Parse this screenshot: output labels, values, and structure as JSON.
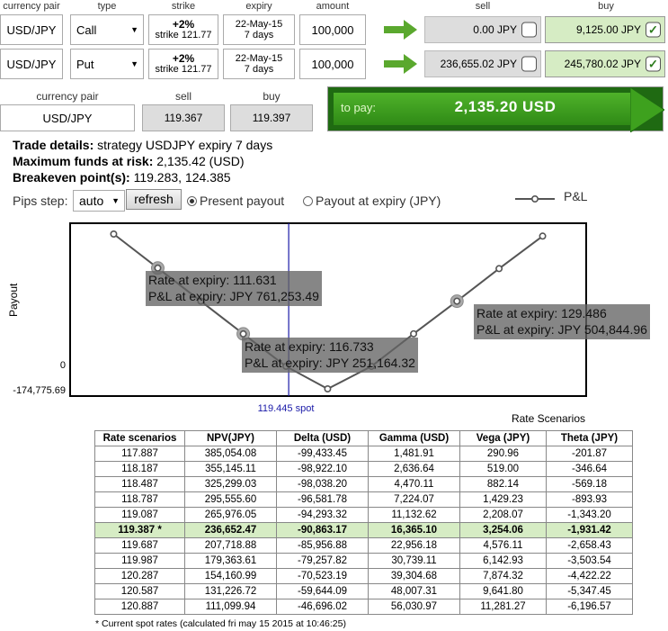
{
  "headers": {
    "currency_pair": "currency pair",
    "type": "type",
    "strike": "strike",
    "expiry": "expiry",
    "amount": "amount",
    "sell": "sell",
    "buy": "buy"
  },
  "legs": [
    {
      "currency_pair": "USD/JPY",
      "type": "Call",
      "strike_top": "+2%",
      "strike_bottom": "strike 121.77",
      "expiry_top": "22-May-15",
      "expiry_bottom": "7 days",
      "amount": "100,000",
      "sell_price": "0.00 JPY",
      "sell_checked": false,
      "buy_price": "9,125.00 JPY",
      "buy_checked": true
    },
    {
      "currency_pair": "USD/JPY",
      "type": "Put",
      "strike_top": "+2%",
      "strike_bottom": "strike 121.77",
      "expiry_top": "22-May-15",
      "expiry_bottom": "7 days",
      "amount": "100,000",
      "sell_price": "236,655.02 JPY",
      "sell_checked": false,
      "buy_price": "245,780.02 JPY",
      "buy_checked": true
    }
  ],
  "spot_box": {
    "label_pair": "currency pair",
    "label_sell": "sell",
    "label_buy": "buy",
    "pair": "USD/JPY",
    "sell": "119.367",
    "buy": "119.397"
  },
  "to_pay": {
    "label": "to pay:",
    "amount": "2,135.20 USD"
  },
  "details": {
    "trade_label": "Trade details:",
    "trade_value": " strategy USDJPY expiry 7 days",
    "risk_label": "Maximum funds at risk:",
    "risk_value": " 2,135.42 (USD)",
    "breakeven_label": "Breakeven point(s):",
    "breakeven_value": " 119.283, 124.385"
  },
  "controls": {
    "pips_label": "Pips step:",
    "pips_value": "auto",
    "refresh_label": "refresh",
    "present_label": "Present payout",
    "present_selected": true,
    "expiry_label": "Payout at expiry (JPY)",
    "expiry_selected": false
  },
  "chart": {
    "legend": "P&L",
    "ylabel": "Payout",
    "y_ticks": [
      "0",
      "-174,775.69"
    ],
    "spot_label": "119.445 spot",
    "tooltips": [
      {
        "rate": "Rate at expiry: 111.631",
        "pl": "P&L at expiry: JPY 761,253.49"
      },
      {
        "rate": "Rate at expiry: 116.733",
        "pl": "P&L at expiry: JPY 251,164.32"
      },
      {
        "rate": "Rate at expiry: 129.486",
        "pl": "P&L at expiry: JPY 504,844.96"
      }
    ]
  },
  "chart_data": {
    "type": "line",
    "title": "",
    "xlabel": "",
    "ylabel": "Payout",
    "series": [
      {
        "name": "P&L",
        "x": [
          109.0,
          111.631,
          114.2,
          116.733,
          119.283,
          121.77,
          124.385,
          126.9,
          129.486,
          132.0,
          134.6
        ],
        "values": [
          1025000,
          761253.49,
          505000,
          251164.32,
          0,
          -174775.69,
          0,
          252000,
          504844.96,
          757000,
          1009000
        ]
      }
    ],
    "highlighted_points": [
      111.631,
      116.733,
      129.486
    ],
    "spot": 119.445,
    "ylim": [
      -174775.69,
      1025000
    ],
    "grid": false
  },
  "scenarios": {
    "title": "Rate Scenarios",
    "columns": [
      "Rate scenarios",
      "NPV(JPY)",
      "Delta (USD)",
      "Gamma (USD)",
      "Vega (JPY)",
      "Theta (JPY)"
    ],
    "rows": [
      [
        "117.887",
        "385,054.08",
        "-99,433.45",
        "1,481.91",
        "290.96",
        "-201.87"
      ],
      [
        "118.187",
        "355,145.11",
        "-98,922.10",
        "2,636.64",
        "519.00",
        "-346.64"
      ],
      [
        "118.487",
        "325,299.03",
        "-98,038.20",
        "4,470.11",
        "882.14",
        "-569.18"
      ],
      [
        "118.787",
        "295,555.60",
        "-96,581.78",
        "7,224.07",
        "1,429.23",
        "-893.93"
      ],
      [
        "119.087",
        "265,976.05",
        "-94,293.32",
        "11,132.62",
        "2,208.07",
        "-1,343.20"
      ],
      [
        "119.387 *",
        "236,652.47",
        "-90,863.17",
        "16,365.10",
        "3,254.06",
        "-1,931.42"
      ],
      [
        "119.687",
        "207,718.88",
        "-85,956.88",
        "22,956.18",
        "4,576.11",
        "-2,658.43"
      ],
      [
        "119.987",
        "179,363.61",
        "-79,257.82",
        "30,739.11",
        "6,142.93",
        "-3,503.54"
      ],
      [
        "120.287",
        "154,160.99",
        "-70,523.19",
        "39,304.68",
        "7,874.32",
        "-4,422.22"
      ],
      [
        "120.587",
        "131,226.72",
        "-59,644.09",
        "48,007.31",
        "9,641.80",
        "-5,347.45"
      ],
      [
        "120.887",
        "111,099.94",
        "-46,696.02",
        "56,030.97",
        "11,281.27",
        "-6,196.57"
      ]
    ],
    "current_row": 5,
    "footnote": "* Current spot rates (calculated fri may 15 2015 at 10:46:25)"
  },
  "colors": {
    "accent_green": "#2f8a16",
    "buy_bg": "#d6ecc4",
    "sell_bg": "#dddddd",
    "spot_line": "#1a1aa8"
  }
}
